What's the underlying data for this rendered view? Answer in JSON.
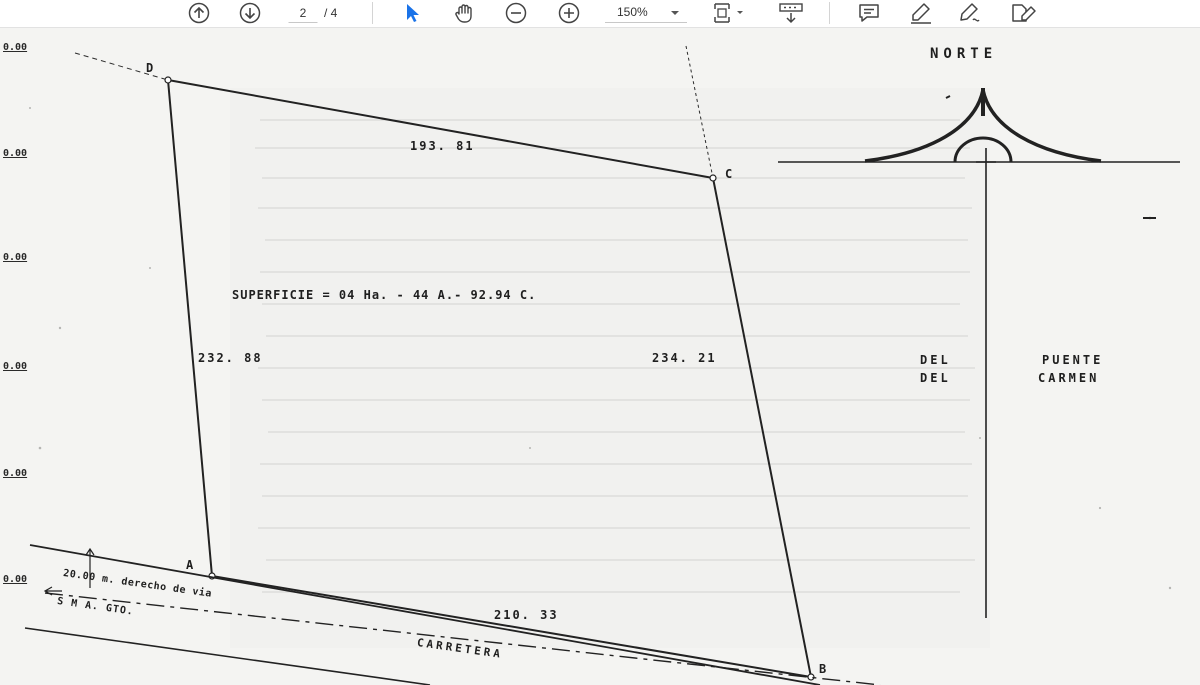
{
  "toolbar": {
    "prev_page_icon": "arrow-up-circle-icon",
    "next_page_icon": "arrow-down-circle-icon",
    "current_page": "2",
    "page_total": "/ 4",
    "select_icon": "cursor-arrow-icon",
    "hand_icon": "hand-pan-icon",
    "zoom_out_icon": "minus-circle-icon",
    "zoom_in_icon": "plus-circle-icon",
    "zoom_level": "150%",
    "fit_icon": "fit-page-icon",
    "scroll_icon": "scroll-mode-icon",
    "comment_icon": "comment-icon",
    "highlight_icon": "highlighter-icon",
    "draw_icon": "pen-draw-icon",
    "fill_sign_icon": "fill-sign-icon",
    "accent_color": "#1a73e8"
  },
  "document": {
    "y_markers": [
      "0.00",
      "0.00",
      "0.00",
      "0.00",
      "0.00",
      "0.00"
    ],
    "vertex_d": "D",
    "vertex_c": "C",
    "vertex_a": "A",
    "vertex_b": "B",
    "side_dc": "193. 81",
    "side_da": "232. 88",
    "side_cb": "234. 21",
    "side_ab": "210. 33",
    "superficie": "SUPERFICIE  = 04 Ha. - 44 A.- 92.94 C.",
    "north_label": "NORTE",
    "del_1": "DEL",
    "del_2": "DEL",
    "puente": "PUENTE",
    "carmen": "CARMEN",
    "derecho_via": "20.00 m.  derecho  de via",
    "sma_gto": "S M A. GTO.",
    "carretera": "CARRETERA"
  }
}
